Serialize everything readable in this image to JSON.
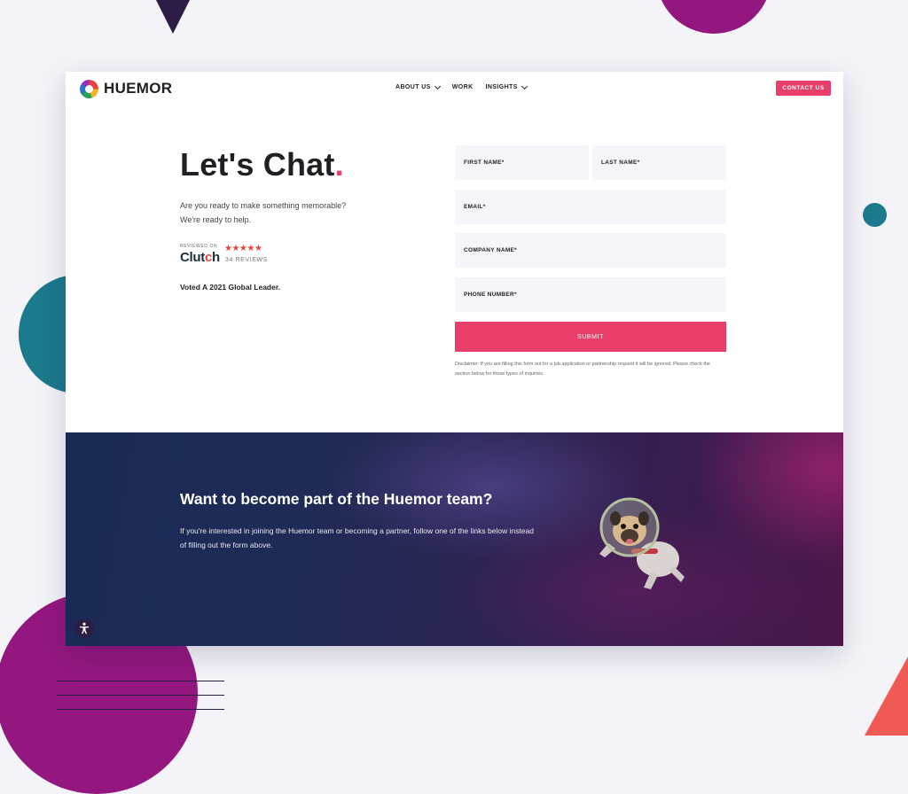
{
  "header": {
    "logo_text": "HUEMOR",
    "nav": [
      {
        "label": "ABOUT US",
        "dropdown": true
      },
      {
        "label": "WORK",
        "dropdown": false
      },
      {
        "label": "INSIGHTS",
        "dropdown": true
      }
    ],
    "contact_label": "CONTACT US"
  },
  "hero": {
    "title": "Let's Chat",
    "title_dot": ".",
    "intro_line1": "Are you ready to make something memorable?",
    "intro_line2": "We're ready to help.",
    "clutch": {
      "reviewed_on": "REVIEWED ON",
      "name": "Clutch",
      "stars": "★★★★★",
      "reviews": "34 REVIEWS"
    },
    "voted": "Voted A 2021 Global Leader."
  },
  "form": {
    "first_name": "FIRST NAME*",
    "last_name": "LAST NAME*",
    "email": "EMAIL*",
    "company": "COMPANY NAME*",
    "phone": "PHONE NUMBER*",
    "submit": "SUBMIT",
    "disclaimer": "Disclaimer: If you are filling this form out for a job application or partnership request it will be ignored. Please check the section below for those types of inquiries."
  },
  "banner": {
    "title": "Want to become part of the Huemor team?",
    "text": "If you're interested in joining the Huemor team or becoming a partner, follow one of the links below instead of filling out the form above."
  },
  "colors": {
    "accent": "#e83e69",
    "dark_purple": "#2c1d46",
    "teal": "#1b7a8c",
    "magenta": "#93177f",
    "coral": "#ef5b54"
  },
  "icons": {
    "accessibility": "accessibility-icon",
    "astronaut": "astronaut-pug-icon"
  }
}
